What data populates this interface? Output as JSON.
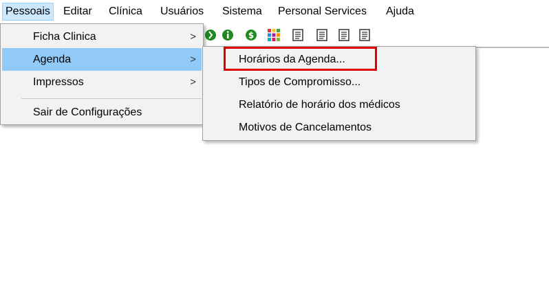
{
  "menubar": {
    "items": [
      "Pessoais",
      "Editar",
      "Clínica",
      "Usuários",
      "Sistema",
      "Personal Services",
      "Ajuda"
    ]
  },
  "toolbar": {
    "icons": [
      "green-circle-icon",
      "green-info-icon",
      "green-dollar-icon",
      "color-grid-icon",
      "document-icon",
      "document-icon",
      "document-icon",
      "document-icon"
    ]
  },
  "menu_pessoais": {
    "items": [
      {
        "label": "Ficha Clinica",
        "arrow": ">"
      },
      {
        "label": "Agenda",
        "arrow": ">"
      },
      {
        "label": "Impressos",
        "arrow": ">"
      },
      {
        "label": "Sair de Configurações"
      }
    ]
  },
  "submenu_agenda": {
    "items": [
      {
        "label": "Horários da Agenda..."
      },
      {
        "label": "Tipos de Compromisso..."
      },
      {
        "label": "Relatório de horário dos médicos"
      },
      {
        "label": "Motivos de Cancelamentos"
      }
    ]
  },
  "colors": {
    "highlight": "#91c9f7",
    "menubar_active": "#cce8ff",
    "annotation_box": "#e00000",
    "icon_green": "#1f8a1f"
  }
}
